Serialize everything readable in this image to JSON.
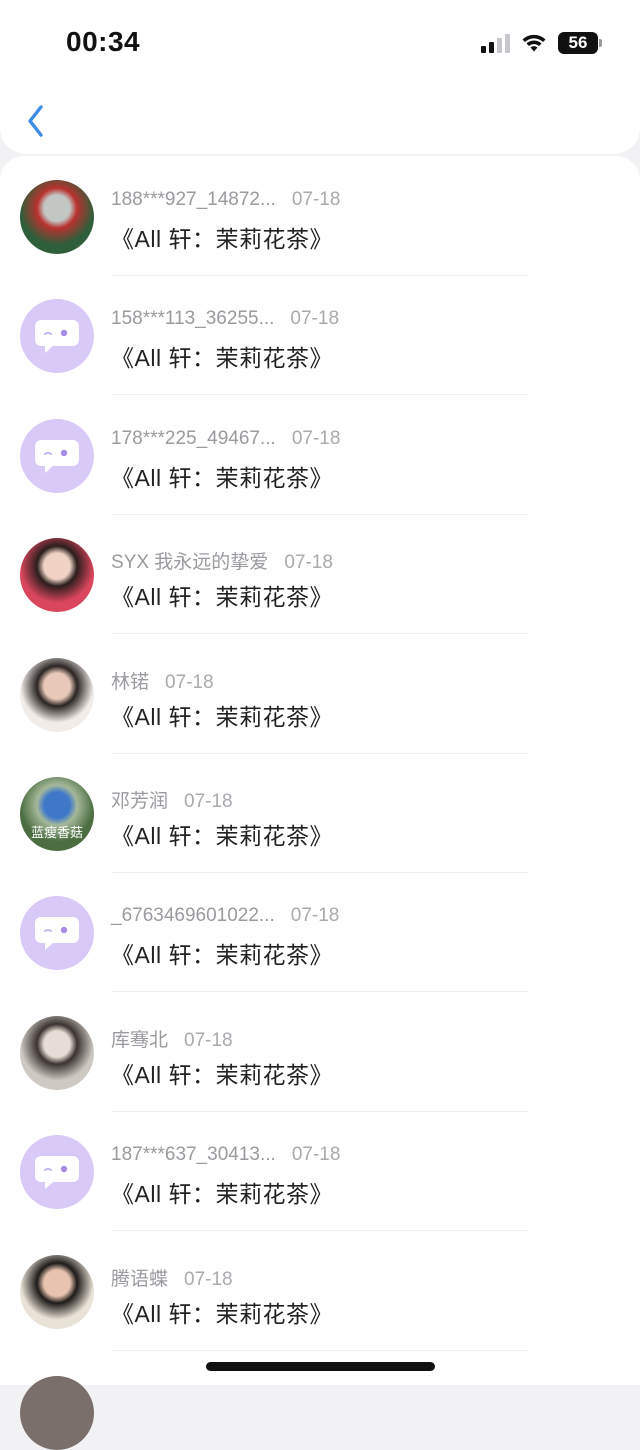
{
  "status_bar": {
    "time": "00:34",
    "battery": "56"
  },
  "nav": {
    "back_icon": "chevron-left-icon"
  },
  "items": [
    {
      "name": "188***927_14872...",
      "date": "07-18",
      "message": "《All 轩：茉莉花茶》",
      "avatar": "photo",
      "avatar_colors": [
        "#2f5e3a",
        "#c2c7c4",
        "#b8322f"
      ]
    },
    {
      "name": "158***113_36255...",
      "date": "07-18",
      "message": "《All 轩：茉莉花茶》",
      "avatar": "default"
    },
    {
      "name": "178***225_49467...",
      "date": "07-18",
      "message": "《All 轩：茉莉花茶》",
      "avatar": "default"
    },
    {
      "name": "SYX 我永远的挚爱",
      "date": "07-18",
      "message": "《All 轩：茉莉花茶》",
      "avatar": "photo",
      "avatar_colors": [
        "#d9465d",
        "#f0d3c5",
        "#2b1e1c"
      ]
    },
    {
      "name": "林锘",
      "date": "07-18",
      "message": "《All 轩：茉莉花茶》",
      "avatar": "photo",
      "avatar_colors": [
        "#f1ece8",
        "#e8c8b8",
        "#2a2422"
      ]
    },
    {
      "name": "邓芳润",
      "date": "07-18",
      "message": "《All 轩：茉莉花茶》",
      "avatar": "photo",
      "avatar_colors": [
        "#4b6d40",
        "#3f78c9",
        "#a5b89a"
      ],
      "avatar_caption": "蓝瘦香菇"
    },
    {
      "name": "_6763469601022...",
      "date": "07-18",
      "message": "《All 轩：茉莉花茶》",
      "avatar": "default"
    },
    {
      "name": "库骞北",
      "date": "07-18",
      "message": "《All 轩：茉莉花茶》",
      "avatar": "photo",
      "avatar_colors": [
        "#cfc9c3",
        "#e8ddd6",
        "#3a3330"
      ]
    },
    {
      "name": "187***637_30413...",
      "date": "07-18",
      "message": "《All 轩：茉莉花茶》",
      "avatar": "default"
    },
    {
      "name": "腾语蝶",
      "date": "07-18",
      "message": "《All 轩：茉莉花茶》",
      "avatar": "photo",
      "avatar_colors": [
        "#e9e2d6",
        "#e8c4b0",
        "#1d1a18"
      ]
    }
  ]
}
